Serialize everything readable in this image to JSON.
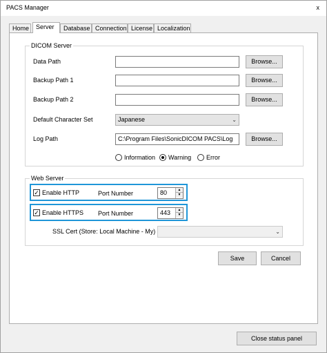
{
  "window": {
    "title": "PACS Manager",
    "close_glyph": "x"
  },
  "tabs": [
    {
      "label": "Home",
      "active": false
    },
    {
      "label": "Server",
      "active": true
    },
    {
      "label": "Database",
      "active": false
    },
    {
      "label": "Connection",
      "active": false
    },
    {
      "label": "License",
      "active": false
    },
    {
      "label": "Localization",
      "active": false
    }
  ],
  "dicom": {
    "group_title": "DICOM Server",
    "data_path": {
      "label": "Data Path",
      "value": "",
      "browse": "Browse..."
    },
    "backup1": {
      "label": "Backup Path 1",
      "value": "",
      "browse": "Browse..."
    },
    "backup2": {
      "label": "Backup Path 2",
      "value": "",
      "browse": "Browse..."
    },
    "charset": {
      "label": "Default Character Set",
      "value": "Japanese"
    },
    "log_path": {
      "label": "Log Path",
      "value": "C:\\Program Files\\SonicDICOM PACS\\Log",
      "browse": "Browse..."
    },
    "log_levels": [
      {
        "label": "Information",
        "selected": false
      },
      {
        "label": "Warning",
        "selected": true
      },
      {
        "label": "Error",
        "selected": false
      }
    ]
  },
  "web": {
    "group_title": "Web Server",
    "http": {
      "label": "Enable HTTP",
      "checked": true,
      "port_label": "Port Number",
      "port": "80"
    },
    "https": {
      "label": "Enable HTTPS",
      "checked": true,
      "port_label": "Port Number",
      "port": "443"
    },
    "ssl_cert": {
      "label": "SSL Cert (Store: Local Machine - My)",
      "value": ""
    },
    "highlight_color": "#1f96d8"
  },
  "actions": {
    "save": "Save",
    "cancel": "Cancel",
    "close_status": "Close status panel"
  }
}
